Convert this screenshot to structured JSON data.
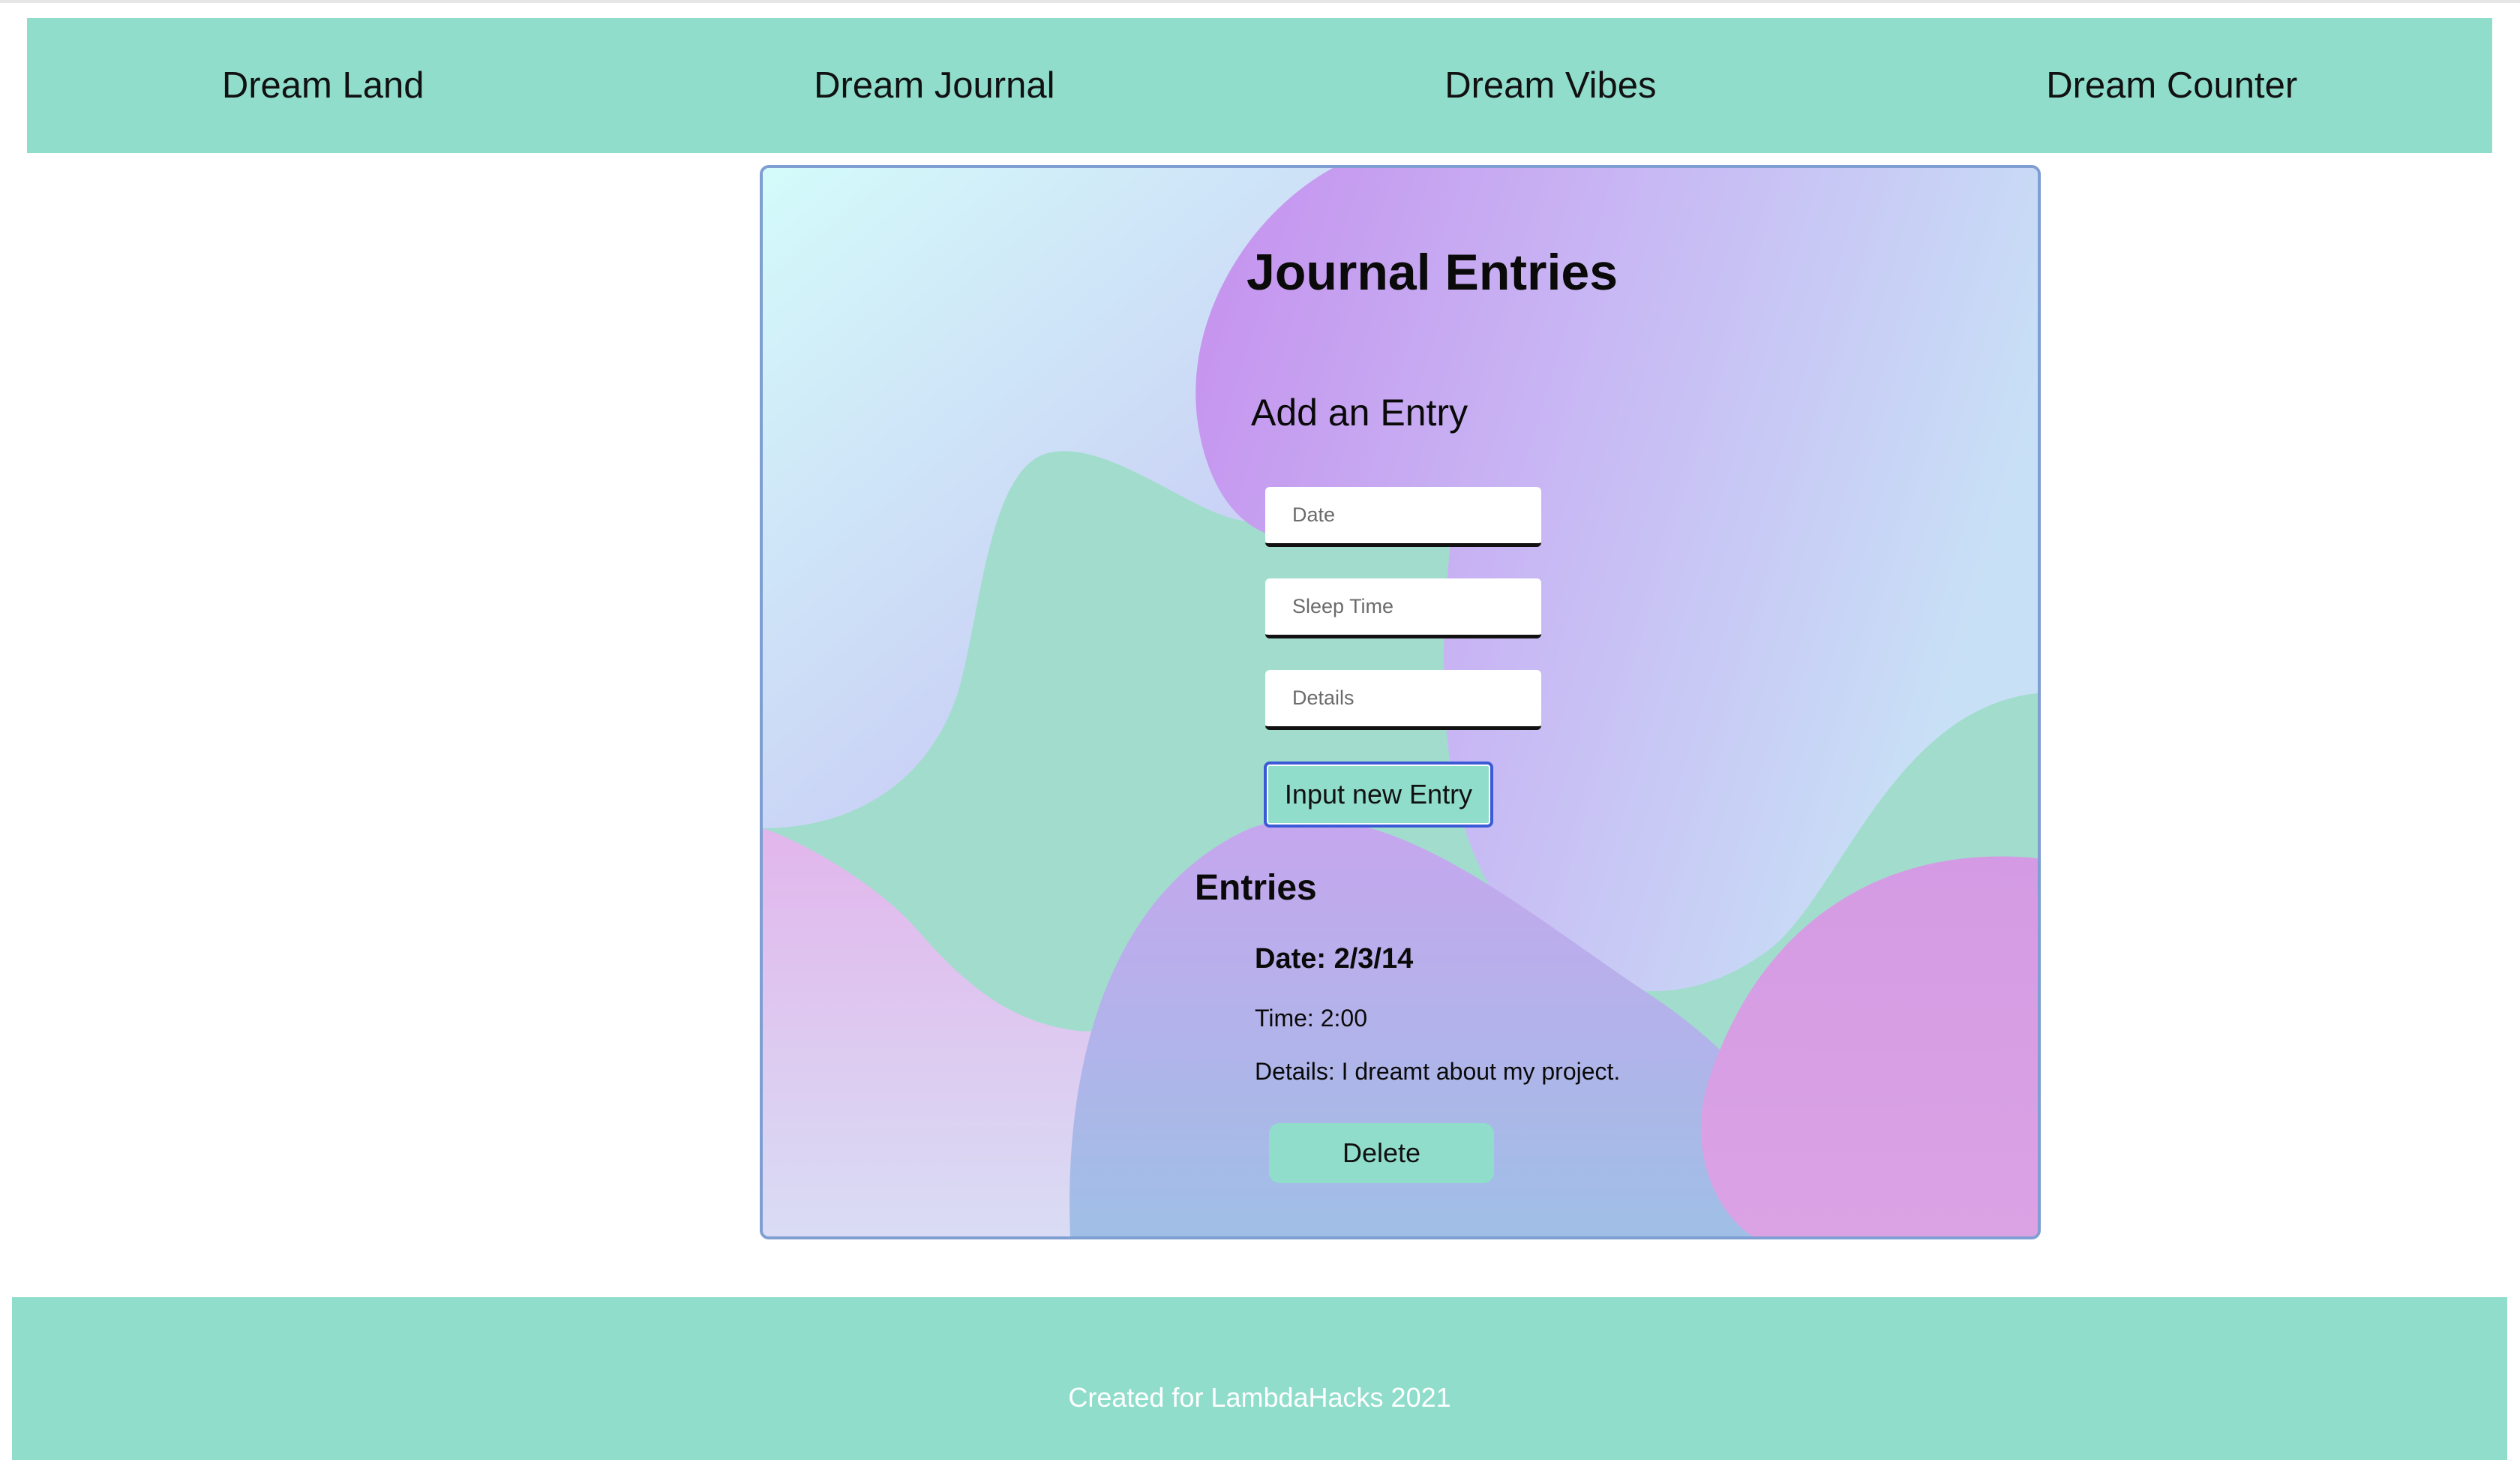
{
  "nav": {
    "items": [
      {
        "label": "Dream Land"
      },
      {
        "label": "Dream Journal"
      },
      {
        "label": "Dream Vibes"
      },
      {
        "label": "Dream Counter"
      }
    ]
  },
  "journal": {
    "title": "Journal Entries",
    "add_heading": "Add an Entry",
    "form": {
      "date_placeholder": "Date",
      "sleep_time_placeholder": "Sleep Time",
      "details_placeholder": "Details",
      "date_value": "",
      "sleep_time_value": "",
      "details_value": "",
      "submit_label": "Input new Entry"
    },
    "entries_heading": "Entries",
    "entries": [
      {
        "date_text": "Date: 2/3/14",
        "time_text": "Time: 2:00",
        "details_text": "Details: I dreamt about my project.",
        "delete_label": "Delete"
      }
    ]
  },
  "footer": {
    "text": "Created for LambdaHacks 2021"
  },
  "colors": {
    "accent": "#90ddcc",
    "card_border": "#7f9ed2",
    "button_focus_border": "#3b5bd6",
    "blob_purple": "#c6a0f0",
    "blob_green": "#a2dccd",
    "blob_pink": "#d89be4",
    "blob_blue": "#a7bfe6"
  }
}
